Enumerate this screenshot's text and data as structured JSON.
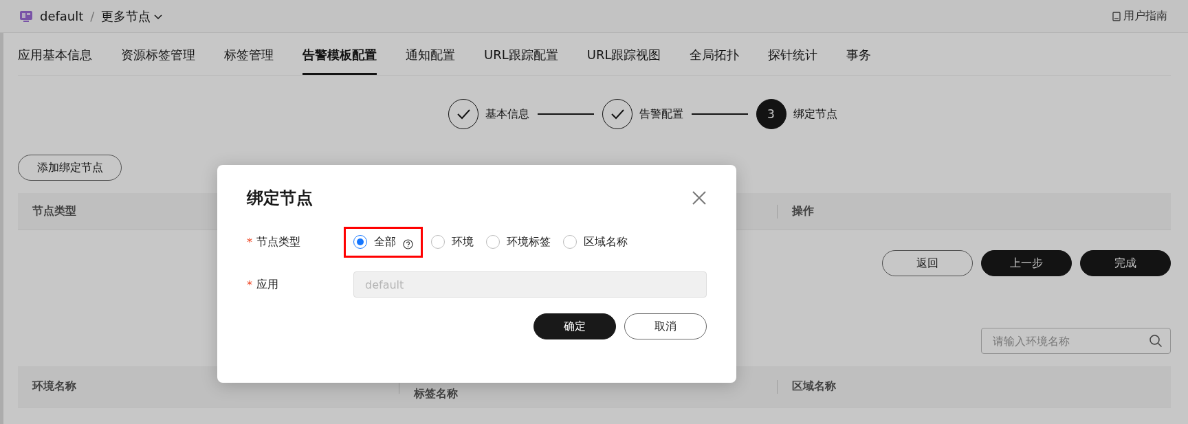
{
  "breadcrumb": {
    "app": "default",
    "separator": "/",
    "current": "更多节点"
  },
  "user_guide": "用户指南",
  "tabs": [
    {
      "label": "应用基本信息",
      "selected": false
    },
    {
      "label": "资源标签管理",
      "selected": false
    },
    {
      "label": "标签管理",
      "selected": false
    },
    {
      "label": "告警模板配置",
      "selected": true
    },
    {
      "label": "通知配置",
      "selected": false
    },
    {
      "label": "URL跟踪配置",
      "selected": false
    },
    {
      "label": "URL跟踪视图",
      "selected": false
    },
    {
      "label": "全局拓扑",
      "selected": false
    },
    {
      "label": "探针统计",
      "selected": false
    },
    {
      "label": "事务",
      "selected": false
    }
  ],
  "steps": [
    {
      "label": "基本信息",
      "kind": "done"
    },
    {
      "label": "告警配置",
      "kind": "done"
    },
    {
      "label": "绑定节点",
      "kind": "current",
      "number": "3"
    }
  ],
  "add_button": "添加绑定节点",
  "node_table": {
    "columns": [
      "节点类型",
      "操作"
    ]
  },
  "actions": [
    {
      "label": "返回",
      "kind": "secondary"
    },
    {
      "label": "上一步",
      "kind": "primary"
    },
    {
      "label": "完成",
      "kind": "primary"
    }
  ],
  "search": {
    "placeholder": "请输入环境名称"
  },
  "env_table": {
    "columns": [
      "环境名称",
      "标签名称",
      "区域名称"
    ]
  },
  "dialog": {
    "title": "绑定节点",
    "fields": [
      {
        "label": "节点类型",
        "required_mark": "*",
        "kind": "radio",
        "options": [
          {
            "label": "全部",
            "selected": true,
            "help": true,
            "highlighted": true
          },
          {
            "label": "环境",
            "selected": false,
            "help": false,
            "highlighted": false
          },
          {
            "label": "环境标签",
            "selected": false,
            "help": false,
            "highlighted": false
          },
          {
            "label": "区域名称",
            "selected": false,
            "help": false,
            "highlighted": false
          }
        ]
      },
      {
        "label": "应用",
        "required_mark": "*",
        "kind": "input",
        "value": "default",
        "disabled": true
      }
    ],
    "buttons": [
      {
        "label": "确定",
        "kind": "primary"
      },
      {
        "label": "取消",
        "kind": "secondary"
      }
    ]
  }
}
